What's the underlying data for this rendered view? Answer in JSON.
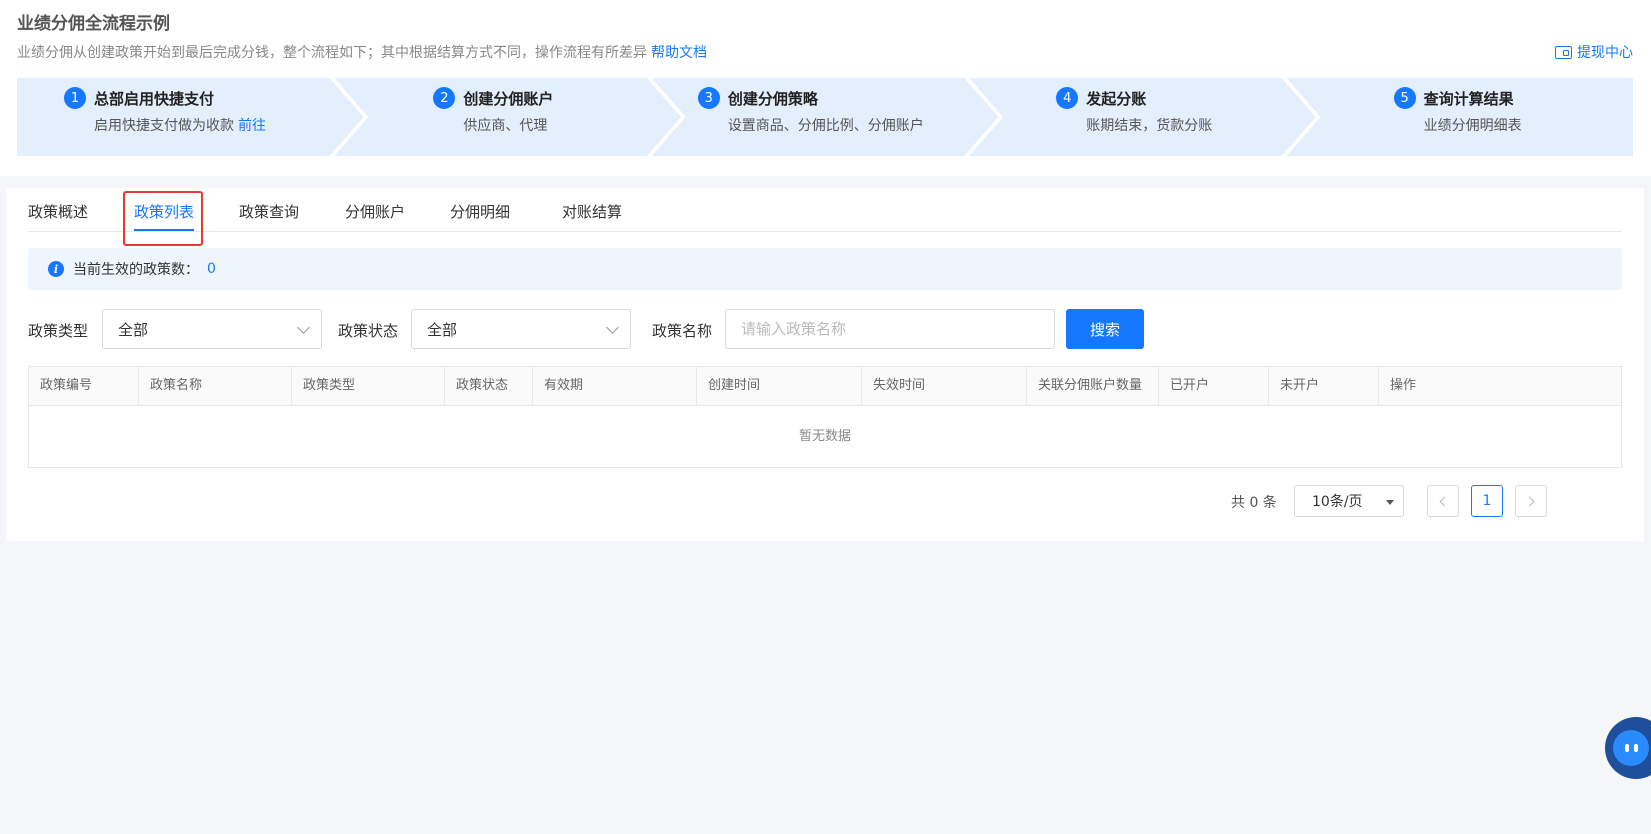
{
  "header": {
    "title": "业绩分佣全流程示例",
    "description": "业绩分佣从创建政策开始到最后完成分钱，整个流程如下；其中根据结算方式不同，操作流程有所差异",
    "help_link": "帮助文档",
    "withdraw_link": "提现中心"
  },
  "steps": [
    {
      "num": "1",
      "title": "总部启用快捷支付",
      "sub": "启用快捷支付做为收款",
      "link": "前往"
    },
    {
      "num": "2",
      "title": "创建分佣账户",
      "sub": "供应商、代理"
    },
    {
      "num": "3",
      "title": "创建分佣策略",
      "sub": "设置商品、分佣比例、分佣账户"
    },
    {
      "num": "4",
      "title": "发起分账",
      "sub": "账期结束，货款分账"
    },
    {
      "num": "5",
      "title": "查询计算结果",
      "sub": "业绩分佣明细表"
    }
  ],
  "tabs": [
    "政策概述",
    "政策列表",
    "政策查询",
    "分佣账户",
    "分佣明细",
    "对账结算"
  ],
  "active_tab": "政策列表",
  "info": {
    "label": "当前生效的政策数：",
    "count": "0"
  },
  "filters": {
    "type_label": "政策类型",
    "type_value": "全部",
    "status_label": "政策状态",
    "status_value": "全部",
    "name_label": "政策名称",
    "name_placeholder": "请输入政策名称",
    "search_label": "搜索"
  },
  "table": {
    "columns": [
      "政策编号",
      "政策名称",
      "政策类型",
      "政策状态",
      "有效期",
      "创建时间",
      "失效时间",
      "关联分佣账户数量",
      "已开户",
      "未开户",
      "操作"
    ],
    "empty_text": "暂无数据"
  },
  "pagination": {
    "total": "共 0 条",
    "page_size": "10条/页",
    "current_page": "1"
  },
  "colors": {
    "accent": "#1677ff",
    "step_bg": "#e4effd",
    "highlight": "#e53935"
  }
}
